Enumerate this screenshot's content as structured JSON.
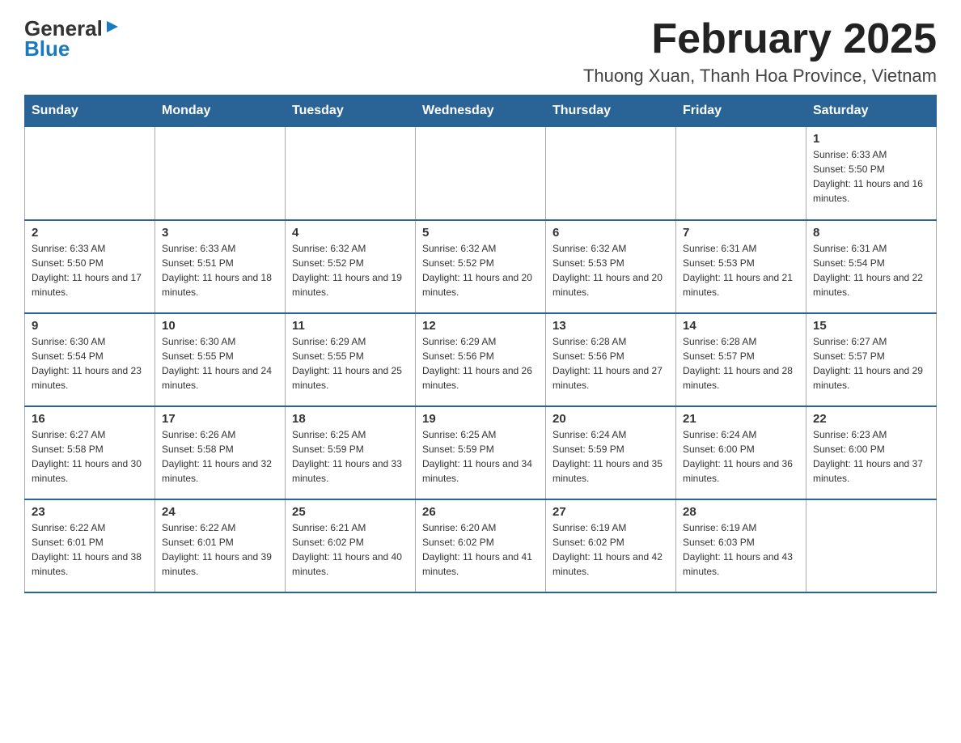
{
  "header": {
    "logo_line1": "General",
    "logo_line2": "Blue",
    "month_title": "February 2025",
    "location": "Thuong Xuan, Thanh Hoa Province, Vietnam"
  },
  "days_of_week": [
    "Sunday",
    "Monday",
    "Tuesday",
    "Wednesday",
    "Thursday",
    "Friday",
    "Saturday"
  ],
  "weeks": [
    [
      {
        "day": "",
        "info": ""
      },
      {
        "day": "",
        "info": ""
      },
      {
        "day": "",
        "info": ""
      },
      {
        "day": "",
        "info": ""
      },
      {
        "day": "",
        "info": ""
      },
      {
        "day": "",
        "info": ""
      },
      {
        "day": "1",
        "info": "Sunrise: 6:33 AM\nSunset: 5:50 PM\nDaylight: 11 hours and 16 minutes."
      }
    ],
    [
      {
        "day": "2",
        "info": "Sunrise: 6:33 AM\nSunset: 5:50 PM\nDaylight: 11 hours and 17 minutes."
      },
      {
        "day": "3",
        "info": "Sunrise: 6:33 AM\nSunset: 5:51 PM\nDaylight: 11 hours and 18 minutes."
      },
      {
        "day": "4",
        "info": "Sunrise: 6:32 AM\nSunset: 5:52 PM\nDaylight: 11 hours and 19 minutes."
      },
      {
        "day": "5",
        "info": "Sunrise: 6:32 AM\nSunset: 5:52 PM\nDaylight: 11 hours and 20 minutes."
      },
      {
        "day": "6",
        "info": "Sunrise: 6:32 AM\nSunset: 5:53 PM\nDaylight: 11 hours and 20 minutes."
      },
      {
        "day": "7",
        "info": "Sunrise: 6:31 AM\nSunset: 5:53 PM\nDaylight: 11 hours and 21 minutes."
      },
      {
        "day": "8",
        "info": "Sunrise: 6:31 AM\nSunset: 5:54 PM\nDaylight: 11 hours and 22 minutes."
      }
    ],
    [
      {
        "day": "9",
        "info": "Sunrise: 6:30 AM\nSunset: 5:54 PM\nDaylight: 11 hours and 23 minutes."
      },
      {
        "day": "10",
        "info": "Sunrise: 6:30 AM\nSunset: 5:55 PM\nDaylight: 11 hours and 24 minutes."
      },
      {
        "day": "11",
        "info": "Sunrise: 6:29 AM\nSunset: 5:55 PM\nDaylight: 11 hours and 25 minutes."
      },
      {
        "day": "12",
        "info": "Sunrise: 6:29 AM\nSunset: 5:56 PM\nDaylight: 11 hours and 26 minutes."
      },
      {
        "day": "13",
        "info": "Sunrise: 6:28 AM\nSunset: 5:56 PM\nDaylight: 11 hours and 27 minutes."
      },
      {
        "day": "14",
        "info": "Sunrise: 6:28 AM\nSunset: 5:57 PM\nDaylight: 11 hours and 28 minutes."
      },
      {
        "day": "15",
        "info": "Sunrise: 6:27 AM\nSunset: 5:57 PM\nDaylight: 11 hours and 29 minutes."
      }
    ],
    [
      {
        "day": "16",
        "info": "Sunrise: 6:27 AM\nSunset: 5:58 PM\nDaylight: 11 hours and 30 minutes."
      },
      {
        "day": "17",
        "info": "Sunrise: 6:26 AM\nSunset: 5:58 PM\nDaylight: 11 hours and 32 minutes."
      },
      {
        "day": "18",
        "info": "Sunrise: 6:25 AM\nSunset: 5:59 PM\nDaylight: 11 hours and 33 minutes."
      },
      {
        "day": "19",
        "info": "Sunrise: 6:25 AM\nSunset: 5:59 PM\nDaylight: 11 hours and 34 minutes."
      },
      {
        "day": "20",
        "info": "Sunrise: 6:24 AM\nSunset: 5:59 PM\nDaylight: 11 hours and 35 minutes."
      },
      {
        "day": "21",
        "info": "Sunrise: 6:24 AM\nSunset: 6:00 PM\nDaylight: 11 hours and 36 minutes."
      },
      {
        "day": "22",
        "info": "Sunrise: 6:23 AM\nSunset: 6:00 PM\nDaylight: 11 hours and 37 minutes."
      }
    ],
    [
      {
        "day": "23",
        "info": "Sunrise: 6:22 AM\nSunset: 6:01 PM\nDaylight: 11 hours and 38 minutes."
      },
      {
        "day": "24",
        "info": "Sunrise: 6:22 AM\nSunset: 6:01 PM\nDaylight: 11 hours and 39 minutes."
      },
      {
        "day": "25",
        "info": "Sunrise: 6:21 AM\nSunset: 6:02 PM\nDaylight: 11 hours and 40 minutes."
      },
      {
        "day": "26",
        "info": "Sunrise: 6:20 AM\nSunset: 6:02 PM\nDaylight: 11 hours and 41 minutes."
      },
      {
        "day": "27",
        "info": "Sunrise: 6:19 AM\nSunset: 6:02 PM\nDaylight: 11 hours and 42 minutes."
      },
      {
        "day": "28",
        "info": "Sunrise: 6:19 AM\nSunset: 6:03 PM\nDaylight: 11 hours and 43 minutes."
      },
      {
        "day": "",
        "info": ""
      }
    ]
  ]
}
